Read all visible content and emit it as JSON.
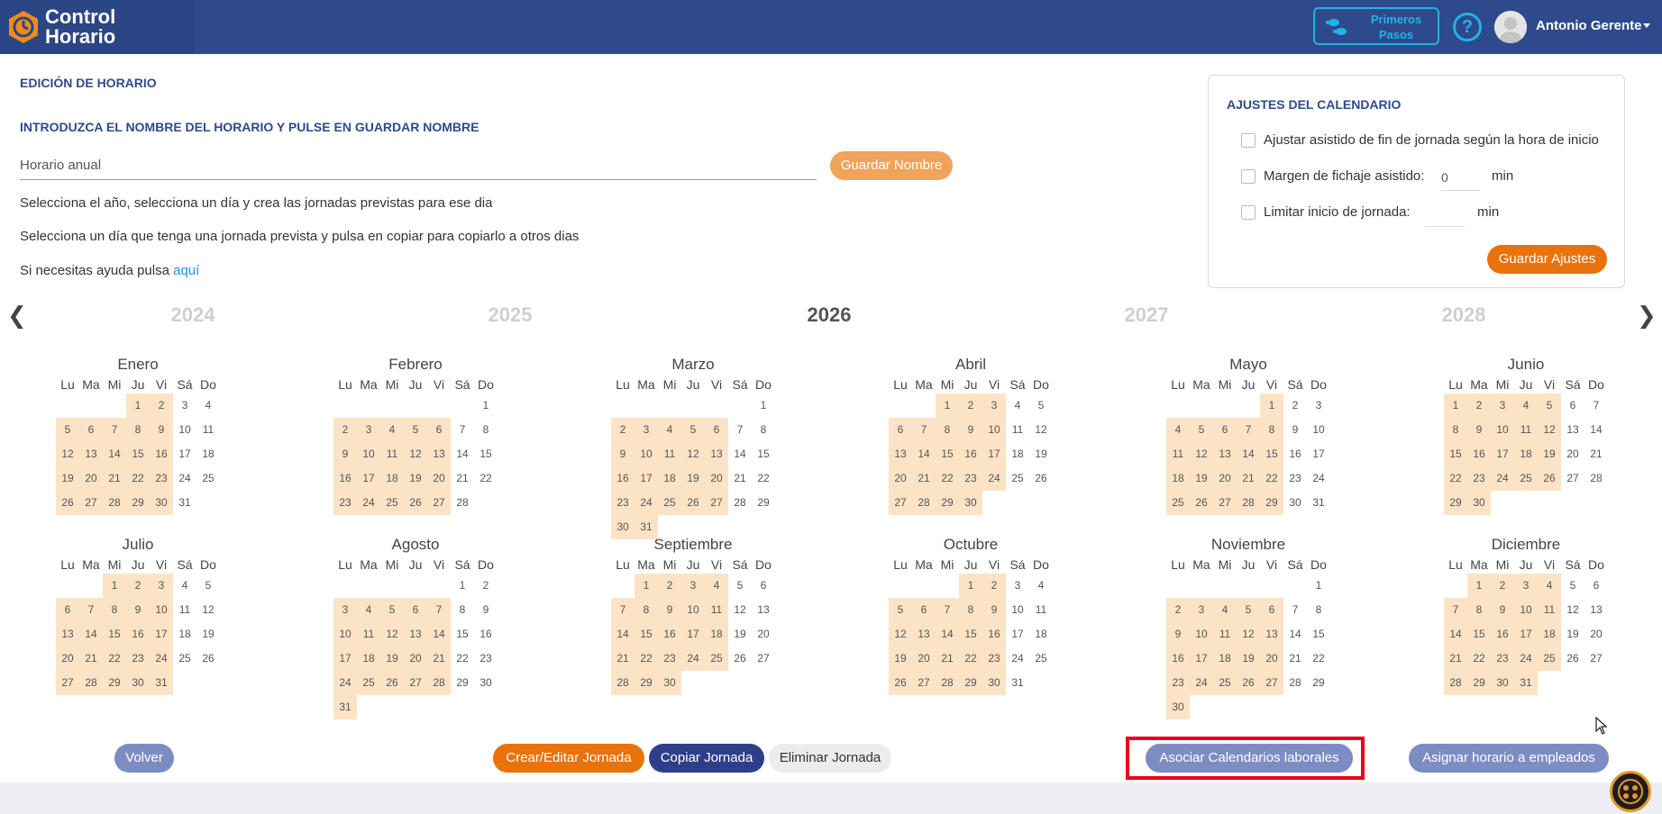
{
  "app": {
    "logo_line1": "Control",
    "logo_line2": "Horario"
  },
  "header": {
    "primeros_line1": "Primeros",
    "primeros_line2": "Pasos",
    "help": "?",
    "user_name": "Antonio Gerente"
  },
  "edit": {
    "title": "EDICIÓN DE HORARIO",
    "subtitle": "INTRODUZCA EL NOMBRE DEL HORARIO Y PULSE EN GUARDAR NOMBRE",
    "name_value": "Horario anual",
    "save_name": "Guardar Nombre",
    "instr1": "Selecciona el año, selecciona un día y crea las jornadas previstas para ese dia",
    "instr2": "Selecciona un día que tenga una jornada prevista y pulsa en copiar para copiarlo a otros dias",
    "help_prefix": "Si necesitas ayuda pulsa ",
    "help_link": "aquí"
  },
  "settings": {
    "title": "AJUSTES DEL CALENDARIO",
    "opt1": "Ajustar asistido de fin de jornada según la hora de inicio",
    "opt2": "Margen de fichaje asistido:",
    "opt2_value": "0",
    "opt2_unit": "min",
    "opt3": "Limitar inicio de jornada:",
    "opt3_value": "",
    "opt3_unit": "min",
    "save": "Guardar Ajustes"
  },
  "years": [
    "2024",
    "2025",
    "2026",
    "2027",
    "2028"
  ],
  "active_year": "2026",
  "dow": [
    "Lu",
    "Ma",
    "Mi",
    "Ju",
    "Vi",
    "Sá",
    "Do"
  ],
  "months": [
    {
      "name": "Enero",
      "offset": 3,
      "days": 31,
      "off": []
    },
    {
      "name": "Febrero",
      "offset": 6,
      "days": 28,
      "off": []
    },
    {
      "name": "Marzo",
      "offset": 6,
      "days": 31,
      "off": []
    },
    {
      "name": "Abril",
      "offset": 2,
      "days": 30,
      "off": []
    },
    {
      "name": "Mayo",
      "offset": 4,
      "days": 31,
      "off": []
    },
    {
      "name": "Junio",
      "offset": 0,
      "days": 30,
      "off": []
    },
    {
      "name": "Julio",
      "offset": 2,
      "days": 31,
      "off": []
    },
    {
      "name": "Agosto",
      "offset": 5,
      "days": 31,
      "off": []
    },
    {
      "name": "Septiembre",
      "offset": 1,
      "days": 30,
      "off": []
    },
    {
      "name": "Octubre",
      "offset": 3,
      "days": 31,
      "off": []
    },
    {
      "name": "Noviembre",
      "offset": 6,
      "days": 30,
      "off": []
    },
    {
      "name": "Diciembre",
      "offset": 1,
      "days": 31,
      "off": []
    }
  ],
  "buttons": {
    "volver": "Volver",
    "crear": "Crear/Editar Jornada",
    "copiar": "Copiar Jornada",
    "eliminar": "Eliminar Jornada",
    "asociar": "Asociar Calendarios laborales",
    "asignar": "Asignar horario a empleados"
  },
  "colors": {
    "header": "#2e4a8c",
    "accent": "#e8720c",
    "workday": "#fde3c6",
    "highlight": "#e8001a"
  }
}
